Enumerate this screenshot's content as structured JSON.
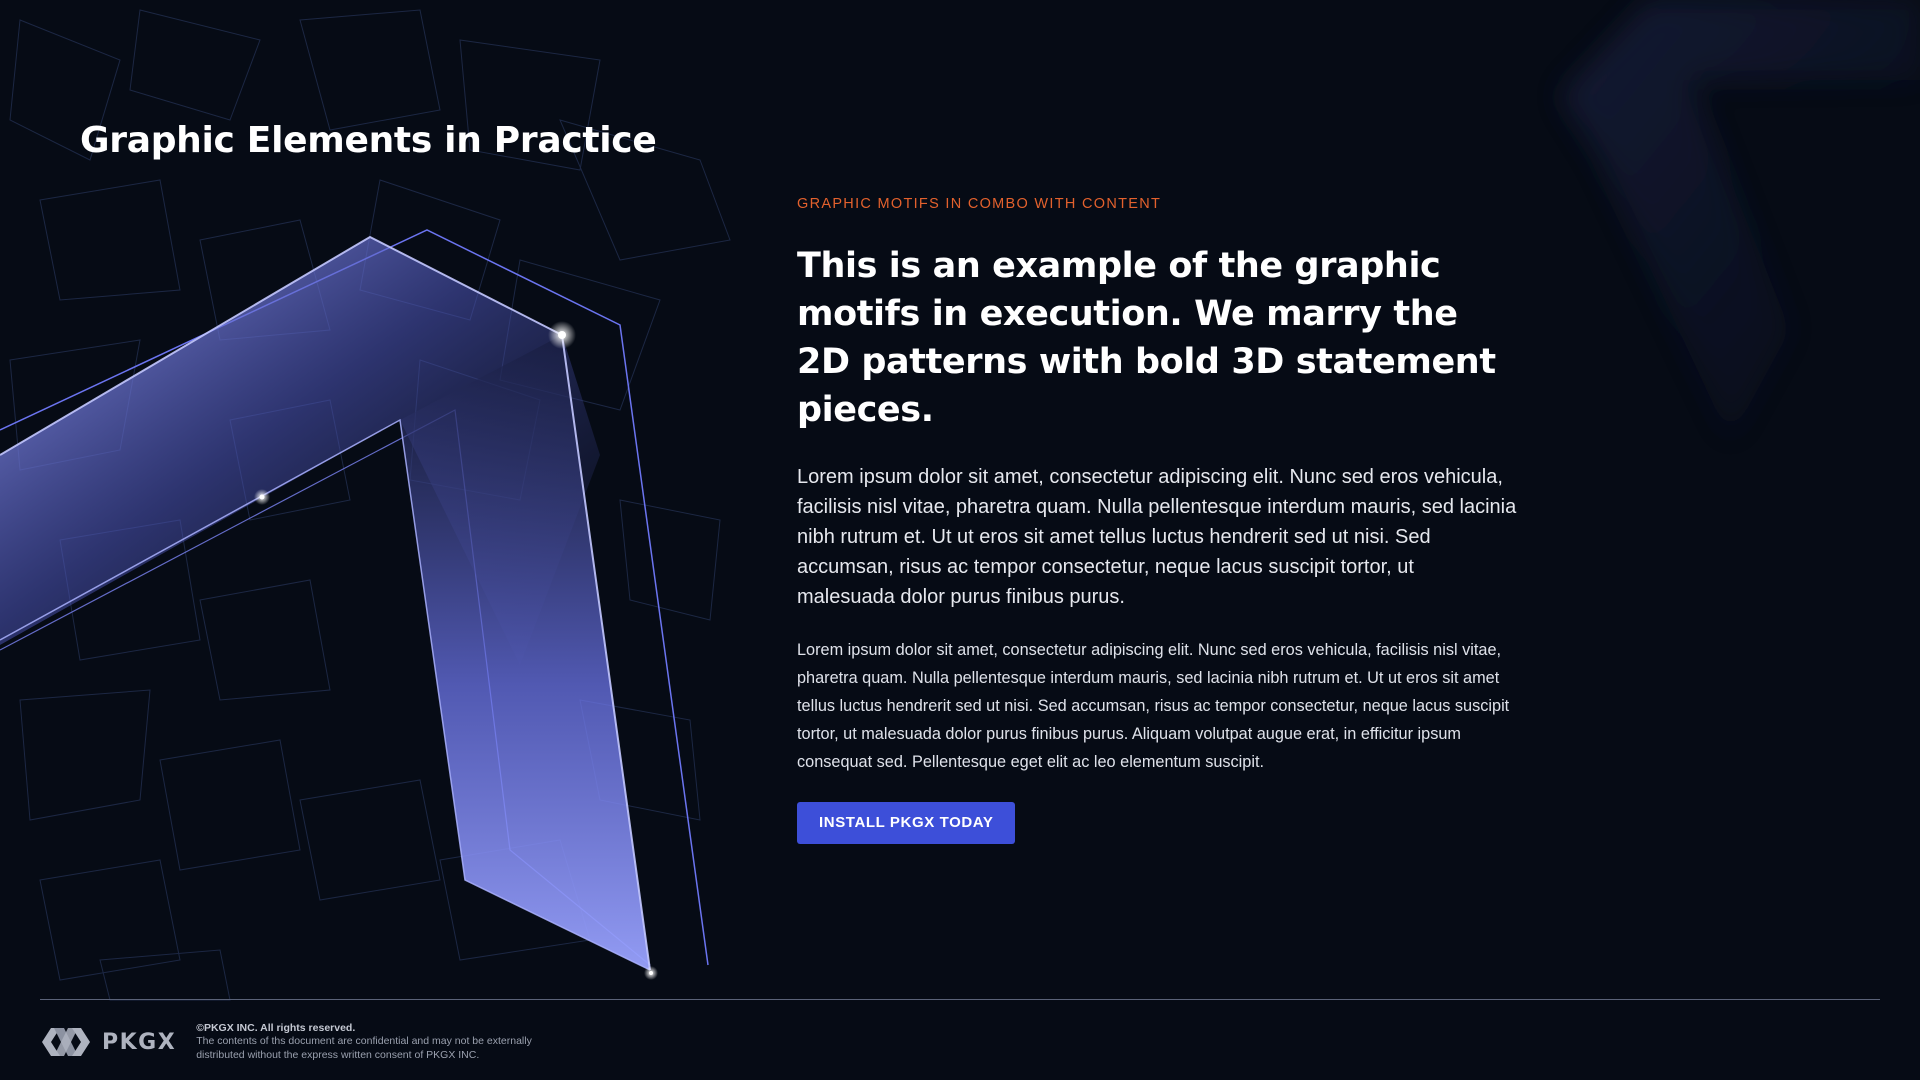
{
  "page": {
    "title": "Graphic Elements in Practice"
  },
  "content": {
    "eyebrow": "GRAPHIC MOTIFS IN COMBO WITH CONTENT",
    "headline": "This is an example of the graphic motifs in execution. We marry the 2D patterns with bold 3D statement pieces.",
    "lead": "Lorem ipsum dolor sit amet, consectetur adipiscing elit. Nunc sed eros vehicula, facilisis nisl vitae, pharetra quam. Nulla pellentesque interdum mauris, sed lacinia nibh rutrum et. Ut ut eros sit amet tellus luctus hendrerit sed ut nisi. Sed accumsan, risus ac tempor consectetur, neque lacus suscipit tortor, ut malesuada dolor purus finibus purus.",
    "body": "Lorem ipsum dolor sit amet, consectetur adipiscing elit. Nunc sed eros vehicula, facilisis nisl vitae, pharetra quam. Nulla pellentesque interdum mauris, sed lacinia nibh rutrum et. Ut ut eros sit amet tellus luctus hendrerit sed ut nisi. Sed accumsan, risus ac tempor consectetur, neque lacus suscipit tortor, ut malesuada dolor purus finibus purus. Aliquam volutpat augue erat, in efficitur ipsum consequat sed. Pellentesque eget elit ac leo elementum suscipit.",
    "cta_label": "INSTALL PKGX TODAY"
  },
  "footer": {
    "logo_text": "PKGX",
    "copyright": "©PKGX INC. All rights reserved.",
    "notice": "The contents of ths document are confidential and may not be externally distributed without the express written consent of PKGX INC."
  },
  "colors": {
    "background": "#060b15",
    "accent_orange": "#e3612d",
    "button_blue": "#3d4fd9",
    "chevron_violet": "#8f97ff"
  },
  "icons": {
    "logo_mark": "pkgx-logo-icon"
  }
}
